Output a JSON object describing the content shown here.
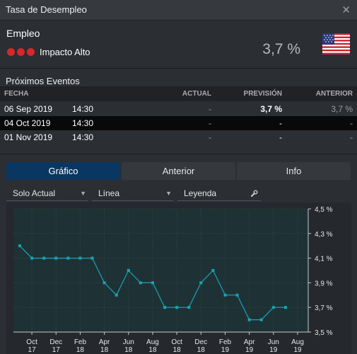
{
  "window": {
    "title": "Tasa de Desempleo"
  },
  "event": {
    "name": "Empleo",
    "impact_label": "Impacto Alto",
    "impact_dots": 3,
    "value": "3,7 %",
    "flag_icon": "us-flag-icon"
  },
  "events": {
    "title": "Próximos Eventos",
    "columns": [
      "FECHA",
      "ACTUAL",
      "PREVISIÓN",
      "ANTERIOR"
    ],
    "rows": [
      {
        "date": "06 Sep 2019",
        "time": "14:30",
        "actual": "-",
        "forecast": "3,7 %",
        "previous": "3,7 %"
      },
      {
        "date": "04 Oct 2019",
        "time": "14:30",
        "actual": "-",
        "forecast": "-",
        "previous": "-"
      },
      {
        "date": "01 Nov 2019",
        "time": "14:30",
        "actual": "-",
        "forecast": "-",
        "previous": "-"
      }
    ]
  },
  "tabs": [
    "Gráfico",
    "Anterior",
    "Info"
  ],
  "controls": {
    "range": "Solo Actual",
    "type": "Línea",
    "legend": "Leyenda"
  },
  "colors": {
    "accent": "#0a3761",
    "impact": "#d8262b",
    "line": "#1aa3b3"
  },
  "chart_data": {
    "type": "line",
    "x": [
      "Sep 17",
      "Oct 17",
      "Nov 17",
      "Dec 17",
      "Jan 18",
      "Feb 18",
      "Mar 18",
      "Apr 18",
      "May 18",
      "Jun 18",
      "Jul 18",
      "Aug 18",
      "Sep 18",
      "Oct 18",
      "Nov 18",
      "Dec 18",
      "Jan 19",
      "Feb 19",
      "Mar 19",
      "Apr 19",
      "May 19",
      "Jun 19",
      "Jul 19",
      "Aug 19"
    ],
    "series": [
      {
        "values": [
          4.2,
          4.1,
          4.1,
          4.1,
          4.1,
          4.1,
          4.1,
          3.9,
          3.8,
          4.0,
          3.9,
          3.9,
          3.7,
          3.7,
          3.7,
          3.9,
          4.0,
          3.8,
          3.8,
          3.6,
          3.6,
          3.7,
          3.7
        ]
      }
    ],
    "x_tick_labels": [
      [
        "Oct",
        "17"
      ],
      [
        "Dec",
        "17"
      ],
      [
        "Feb",
        "18"
      ],
      [
        "Apr",
        "18"
      ],
      [
        "Jun",
        "18"
      ],
      [
        "Aug",
        "18"
      ],
      [
        "Oct",
        "18"
      ],
      [
        "Dec",
        "18"
      ],
      [
        "Feb",
        "19"
      ],
      [
        "Apr",
        "19"
      ],
      [
        "Jun",
        "19"
      ],
      [
        "Aug",
        "19"
      ]
    ],
    "y_ticks": [
      "4,5 %",
      "4,3 %",
      "4,1 %",
      "3,9 %",
      "3,7 %",
      "3,5 %"
    ],
    "ylim": [
      3.5,
      4.5
    ],
    "grid": true
  }
}
